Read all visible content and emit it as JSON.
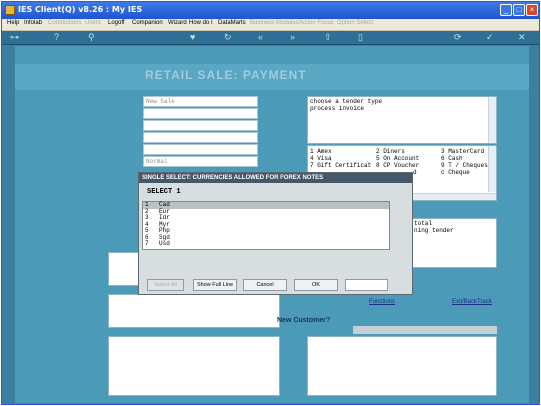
{
  "window": {
    "title": "IES Client(Q) v8.26 : My IES"
  },
  "menu": [
    {
      "label": "Help",
      "enabled": true
    },
    {
      "label": "Infolab",
      "enabled": true
    },
    {
      "label": "Connections",
      "enabled": false
    },
    {
      "label": "Users",
      "enabled": false
    },
    {
      "label": "Logoff",
      "enabled": true
    },
    {
      "label": "Companion",
      "enabled": true
    },
    {
      "label": "Wizard",
      "enabled": true
    },
    {
      "label": "How do I",
      "enabled": true
    },
    {
      "label": "DataMarts",
      "enabled": true
    },
    {
      "label": "Business Modules",
      "enabled": false
    },
    {
      "label": "Action Focus",
      "enabled": false
    },
    {
      "label": "Option Select",
      "enabled": false
    }
  ],
  "toolbar": {
    "icons": [
      "key-icon",
      "help-icon",
      "search-icon",
      "heart-icon",
      "refresh-icon",
      "rewind-icon",
      "forward-icon",
      "upload-icon",
      "document-icon",
      "cycle-icon",
      "check-icon",
      "close-icon"
    ],
    "glyphs": [
      "⊶",
      "?",
      "⚲",
      "♥",
      "↻",
      "«",
      "»",
      "⇧",
      "▯",
      "⟳",
      "✓",
      "✕"
    ]
  },
  "page": {
    "title": "RETAIL SALE: PAYMENT",
    "fields": [
      {
        "value": "New Sale"
      },
      {
        "value": ""
      },
      {
        "value": ""
      },
      {
        "value": ""
      },
      {
        "value": ""
      },
      {
        "value": "Normal"
      }
    ],
    "instructions": [
      "choose a tender type",
      "process invoice"
    ],
    "tenders": [
      [
        "1 Amex",
        "2 Diners",
        "3 MasterCard"
      ],
      [
        "4 Visa",
        "5 On Account",
        "6 Cash"
      ],
      [
        "7 Gift Certificat",
        "8 CP Voucher",
        "9 T / Cheques"
      ],
      [
        "",
        "d",
        "c Cheque"
      ]
    ],
    "right_notes": [
      "total",
      "",
      "ning tender"
    ],
    "links": {
      "functions": "Functions",
      "exit": "Exit/BackTrack"
    },
    "new_customer": "New Customer?"
  },
  "dialog": {
    "title": "SINGLE SELECT: CURRENCIES ALLOWED FOR FOREX NOTES",
    "prompt": "SELECT 1",
    "items": [
      {
        "num": "1",
        "code": "Cad"
      },
      {
        "num": "2",
        "code": "Eur"
      },
      {
        "num": "3",
        "code": "Idr"
      },
      {
        "num": "4",
        "code": "Myr"
      },
      {
        "num": "5",
        "code": "Php"
      },
      {
        "num": "6",
        "code": "Sgd"
      },
      {
        "num": "7",
        "code": "Usd"
      }
    ],
    "selected_index": 0,
    "buttons": {
      "select_all": "Select All",
      "show_full_line": "Show Full Line",
      "cancel": "Cancel",
      "ok": "OK"
    },
    "input_value": ""
  },
  "colors": {
    "background": "#4a9ab8",
    "titlebar": "#1f55d1",
    "dialog_title": "#44586a"
  }
}
